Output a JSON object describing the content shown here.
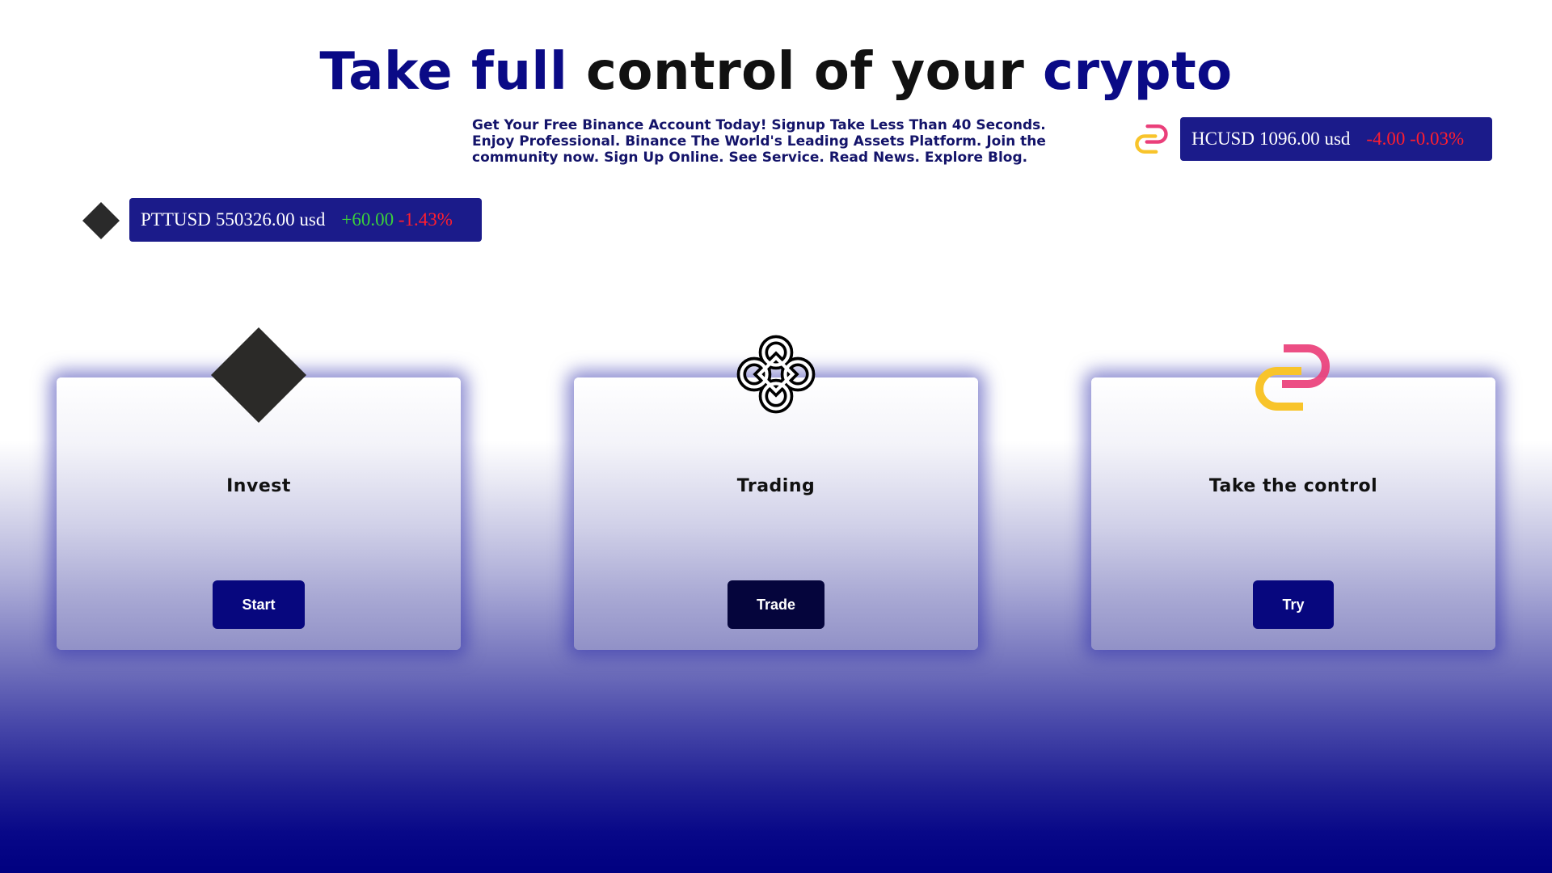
{
  "headline": {
    "part1": "Take full",
    "part2": " control of your ",
    "part3": "crypto"
  },
  "promo": {
    "text": "Get Your Free Binance Account Today! Signup Take Less Than 40 Seconds. Enjoy Professional. Binance The World's Leading Assets Platform. Join the community now. Sign Up Online. See Service. Read News. Explore Blog."
  },
  "tickers": [
    {
      "symbol": "HCUSD",
      "price": "1096.00 usd",
      "change": "-4.00",
      "percent": "-0.03%",
      "icon": "hc-coin-icon"
    },
    {
      "symbol": "PTTUSD",
      "price": "550326.00 usd",
      "change": "+60.00",
      "percent": "-1.43%",
      "icon": "ptt-coin-icon"
    }
  ],
  "cards": [
    {
      "title": "Invest",
      "button": "Start",
      "icon": "diamond-icon"
    },
    {
      "title": "Trading",
      "button": "Trade",
      "icon": "knot-icon"
    },
    {
      "title": "Take the control",
      "button": "Try",
      "icon": "hc-coin-icon"
    }
  ],
  "colors": {
    "accent_blue": "#0a0a86",
    "ticker_bg": "#1b1b8a",
    "positive": "#3ad13a",
    "negative": "#ff1e2e",
    "card_shadow": "#2828aa"
  }
}
